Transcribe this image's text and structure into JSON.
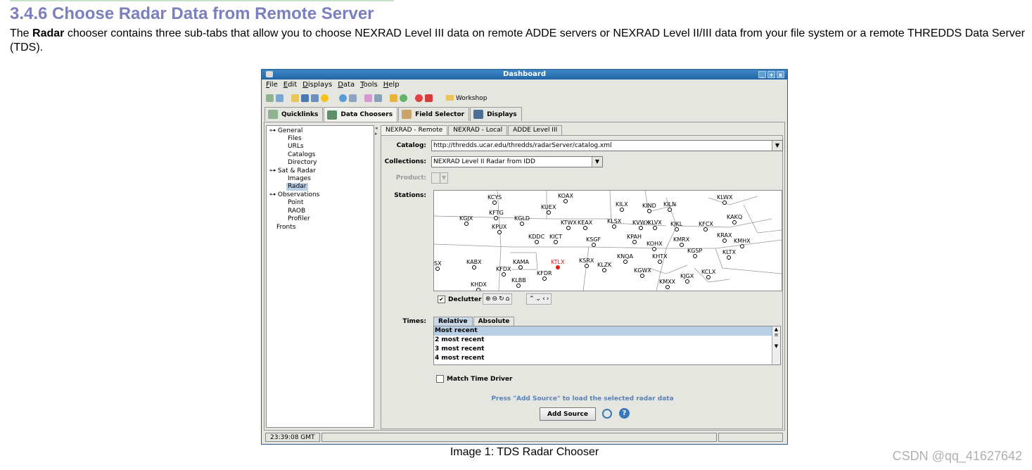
{
  "doc": {
    "title": "3.4.6 Choose Radar Data from Remote Server",
    "para_lead": "The ",
    "para_bold": "Radar",
    "para_rest": " chooser contains three sub-tabs that allow you to choose NEXRAD Level III data on remote ADDE servers or NEXRAD Level II/III data from your file system or a remote THREDDS Data Server (TDS).",
    "caption": "Image 1: TDS Radar Chooser",
    "watermark": "CSDN @qq_41627642"
  },
  "window": {
    "title": "Dashboard",
    "controls": [
      "_",
      "+",
      "x"
    ],
    "menus": [
      "File",
      "Edit",
      "Displays",
      "Data",
      "Tools",
      "Help"
    ],
    "toolbar_workshop": "Workshop",
    "tabs": [
      "Quicklinks",
      "Data Choosers",
      "Field Selector",
      "Displays"
    ],
    "active_tab": "Data Choosers",
    "tree": {
      "general": "General",
      "files": "Files",
      "urls": "URLs",
      "catalogs": "Catalogs",
      "directory": "Directory",
      "sat_radar": "Sat & Radar",
      "images": "Images",
      "radar": "Radar",
      "observations": "Observations",
      "point": "Point",
      "raob": "RAOB",
      "profiler": "Profiler",
      "fronts": "Fronts"
    },
    "subtabs": [
      "NEXRAD - Remote",
      "NEXRAD - Local",
      "ADDE Level III"
    ],
    "catalog_label": "Catalog:",
    "catalog_value": "http://thredds.ucar.edu/thredds/radarServer/catalog.xml",
    "collections_label": "Collections:",
    "collections_value": "NEXRAD Level II Radar from IDD",
    "product_label": "Product:",
    "stations_label": "Stations:",
    "selected_station": "KTLX",
    "declutter_label": "Declutter",
    "declutter_checked": "✔",
    "times_label": "Times:",
    "time_tabs": [
      "Relative",
      "Absolute"
    ],
    "time_options": [
      "Most recent",
      "2 most recent",
      "3 most recent",
      "4 most recent"
    ],
    "match_time_driver": "Match Time Driver",
    "press_hint": "Press \"Add Source\" to load the selected radar data",
    "add_source": "Add Source",
    "status_time": "23:39:08 GMT"
  },
  "stations": [
    "KCYS",
    "KGJX",
    "KFTG",
    "KPUX",
    "KGLD",
    "KUEX",
    "KOAX",
    "KILX",
    "KIND",
    "KILN",
    "KLWX",
    "KDDC",
    "KICT",
    "KTWX",
    "KEAX",
    "KLSX",
    "KVWX",
    "KLVX",
    "KJKL",
    "KFCX",
    "KAKQ",
    "KSGF",
    "KPAH",
    "KOHX",
    "KMRX",
    "KRAX",
    "KMHX",
    "KGSP",
    "KLTX",
    "KABX",
    "KFDX",
    "KAMA",
    "KTLX",
    "KSRX",
    "KLZK",
    "KNQA",
    "KHTX",
    "KFDR",
    "KLBB",
    "KGWX",
    "KJGX",
    "KCLX",
    "KMXX",
    "KHDX",
    "SX"
  ],
  "colors": {
    "highlight": "#e01818",
    "title": "#7b7fbd",
    "accent": "#3a77b8"
  }
}
